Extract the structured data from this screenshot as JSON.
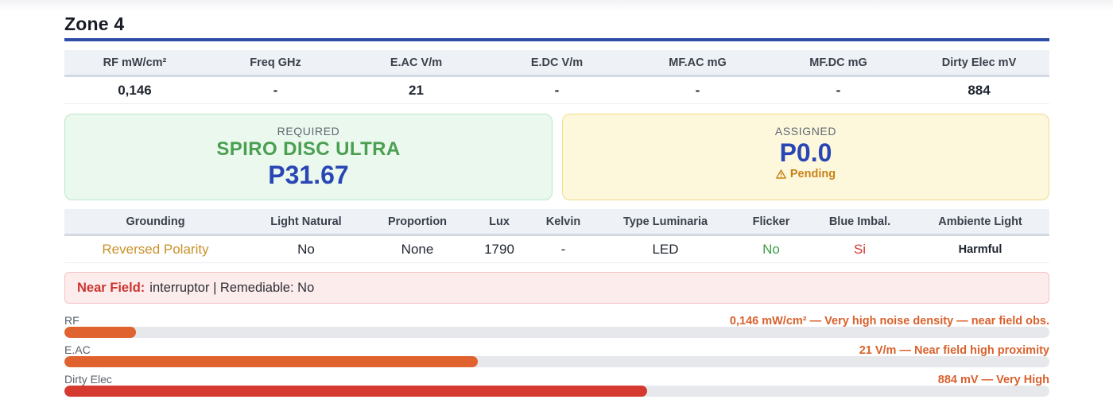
{
  "zone": {
    "title": "Zone 4"
  },
  "measurements": {
    "headers": [
      "RF mW/cm²",
      "Freq GHz",
      "E.AC V/m",
      "E.DC V/m",
      "MF.AC mG",
      "MF.DC mG",
      "Dirty Elec mV"
    ],
    "values": [
      "0,146",
      "-",
      "21",
      "-",
      "-",
      "-",
      "884"
    ]
  },
  "required": {
    "label": "REQUIRED",
    "product": "SPIRO DISC ULTRA",
    "price": "P31.67"
  },
  "assigned": {
    "label": "ASSIGNED",
    "price": "P0.0",
    "status": "Pending",
    "status_icon": "warning-icon"
  },
  "lighting": {
    "headers": [
      "Grounding",
      "Light Natural",
      "Proportion",
      "Lux",
      "Kelvin",
      "Type Luminaria",
      "Flicker",
      "Blue Imbal.",
      "Ambiente Light"
    ],
    "values": [
      "Reversed Polarity",
      "No",
      "None",
      "1790",
      "-",
      "LED",
      "No",
      "Si",
      "Harmful"
    ]
  },
  "near_field": {
    "key": "Near Field:",
    "text": "interruptor | Remediable: No"
  },
  "bars": [
    {
      "label": "RF",
      "description": "0,146 mW/cm² — Very high noise density — near field obs.",
      "fill_fraction": 0.073,
      "color": "#e0622e"
    },
    {
      "label": "E.AC",
      "description": "21 V/m — Near field high proximity",
      "fill_fraction": 0.42,
      "color": "#e0622e"
    },
    {
      "label": "Dirty Elec",
      "description": "884 mV — Very High",
      "fill_fraction": 0.592,
      "color": "#d53a30"
    }
  ],
  "colors": {
    "accent": "#2e4da8",
    "required_green": "#4a9f50",
    "price_blue": "#2a46b4",
    "pending_orange": "#c9821a",
    "danger_red": "#cc3530"
  }
}
